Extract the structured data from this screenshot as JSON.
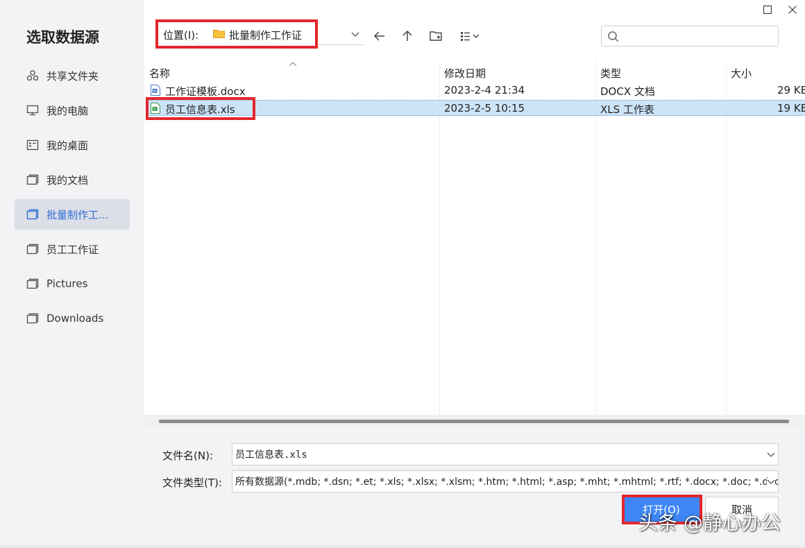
{
  "dialog": {
    "title": "选取数据源"
  },
  "sidebar": {
    "items": [
      {
        "label": "共享文件夹",
        "icon": "share-icon"
      },
      {
        "label": "我的电脑",
        "icon": "monitor-icon"
      },
      {
        "label": "我的桌面",
        "icon": "desktop-icon"
      },
      {
        "label": "我的文档",
        "icon": "folder-icon"
      },
      {
        "label": "批量制作工...",
        "icon": "folder-icon",
        "active": true
      },
      {
        "label": "员工工作证",
        "icon": "folder-icon"
      },
      {
        "label": "Pictures",
        "icon": "folder-icon"
      },
      {
        "label": "Downloads",
        "icon": "folder-icon"
      }
    ]
  },
  "location": {
    "label": "位置(I):",
    "folder": "批量制作工作证"
  },
  "search": {
    "placeholder": ""
  },
  "columns": {
    "name": "名称",
    "date": "修改日期",
    "type": "类型",
    "size": "大小"
  },
  "files": [
    {
      "name": "工作证模板.docx",
      "date": "2023-2-4 21:34",
      "type": "DOCX 文档",
      "size": "29 KB",
      "icon": "docx-file-icon"
    },
    {
      "name": "员工信息表.xls",
      "date": "2023-2-5 10:15",
      "type": "XLS 工作表",
      "size": "19 KB",
      "icon": "xls-file-icon",
      "selected": true
    }
  ],
  "form": {
    "filename_label": "文件名(N):",
    "filename_value": "员工信息表.xls",
    "filetype_label": "文件类型(T):",
    "filetype_value": "所有数据源(*.mdb; *.dsn; *.et; *.xls; *.xlsx; *.xlsm; *.htm; *.html; *.asp; *.mht; *.mhtml; *.rtf; *.docx; *.doc; *.docm; *"
  },
  "buttons": {
    "open": "打开(O)",
    "cancel": "取消"
  },
  "watermark": "头条 @静心办公",
  "colors": {
    "accent": "#3e86f5",
    "highlight_box": "#e3262d",
    "selection": "#cde4f7",
    "sidebar_bg": "#f3f3f5"
  }
}
